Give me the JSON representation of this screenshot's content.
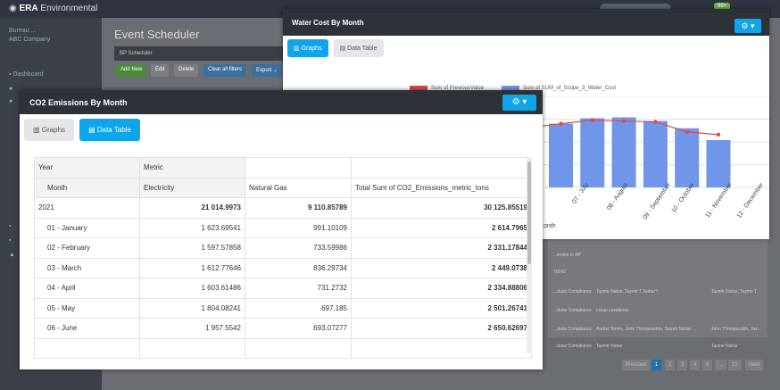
{
  "app": {
    "brand": "ERA",
    "brand_rest": " Environmental",
    "badge": "99+"
  },
  "sidebar": {
    "company_line1": "Bureau ...",
    "company_line2": "ABC Company",
    "items": [
      "Dashboard",
      "",
      ""
    ]
  },
  "page": {
    "title": "Event Scheduler",
    "panel_title": "BP Scheduler"
  },
  "toolbar": {
    "buttons": [
      "Add New",
      "Edit",
      "Delete",
      "Clear all filters",
      "Export ⌄"
    ]
  },
  "bg_table": {
    "cells": [
      "...ection to BP",
      "75042",
      "...dular Compliance",
      "Tazmir Nahar, Tazmir T Nahar?",
      "Tazmir Nahar, Tazmir T",
      "...dular Compliance",
      "Imran cavalleros",
      "...dular Compliance",
      "Andrei Torres, John Thompsoddn, Tazmir Nahar",
      "John Thompsoddn, Taz...",
      "...dular Compliance",
      "Tazmir Nahar",
      "Tazmir Nahar"
    ],
    "pager": [
      "Previous",
      "1",
      "2",
      "3",
      "4",
      "5",
      "...",
      "15",
      "Next"
    ]
  },
  "water_card": {
    "title": "Water Cost By Month",
    "tabs": [
      "Graphs",
      "Data Table"
    ],
    "legend": [
      "Sum of PreviousValue",
      "Sum of SUM_of_Scope_3_Water_Cost"
    ],
    "axis_label": "onth",
    "colors": {
      "bar": "#6f96e8",
      "line": "#e04848",
      "accent": "#0ea5e9"
    }
  },
  "chart_data": {
    "type": "bar",
    "categories": [
      "07 - July",
      "08 - August",
      "09 - September",
      "10 - October",
      "11 - November",
      "12 - December"
    ],
    "series": [
      {
        "name": "Sum of SUM_of_Scope_3_Water_Cost",
        "type": "bar",
        "values": [
          70,
          76,
          77,
          73,
          65,
          52
        ]
      },
      {
        "name": "Sum of PreviousValue",
        "type": "line",
        "values": [
          70,
          74,
          73,
          72,
          61,
          58
        ]
      }
    ],
    "ylim": [
      0,
      100
    ],
    "xlabel": "onth",
    "ylabel": "",
    "grid": true,
    "legend": "top"
  },
  "co2_card": {
    "title": "CO2 Emissions By Month",
    "tabs": [
      "Graphs",
      "Data Table"
    ],
    "header_row1": [
      "Year",
      "Metric",
      "",
      ""
    ],
    "header_row2": [
      "Month",
      "Electricity",
      "Natural Gas",
      "Total Sum of CO2_Emissions_metric_tons"
    ],
    "rows": [
      [
        "2021",
        "21 014.9973",
        "9 110.85789",
        "30 125.85519"
      ],
      [
        "01 - January",
        "1 623.69541",
        "991.10109",
        "2 614.7965"
      ],
      [
        "02 - February",
        "1 597.57858",
        "733.59986",
        "2 331.17844"
      ],
      [
        "03 - March",
        "1 612.77646",
        "836.29734",
        "2 449.0738"
      ],
      [
        "04 - April",
        "1 603.61486",
        "731.2732",
        "2 334.88806"
      ],
      [
        "05 - May",
        "1 804.08241",
        "697.185",
        "2 501.26741"
      ],
      [
        "06 - June",
        "1 957.5542",
        "693.07277",
        "2 650.62697"
      ]
    ]
  }
}
